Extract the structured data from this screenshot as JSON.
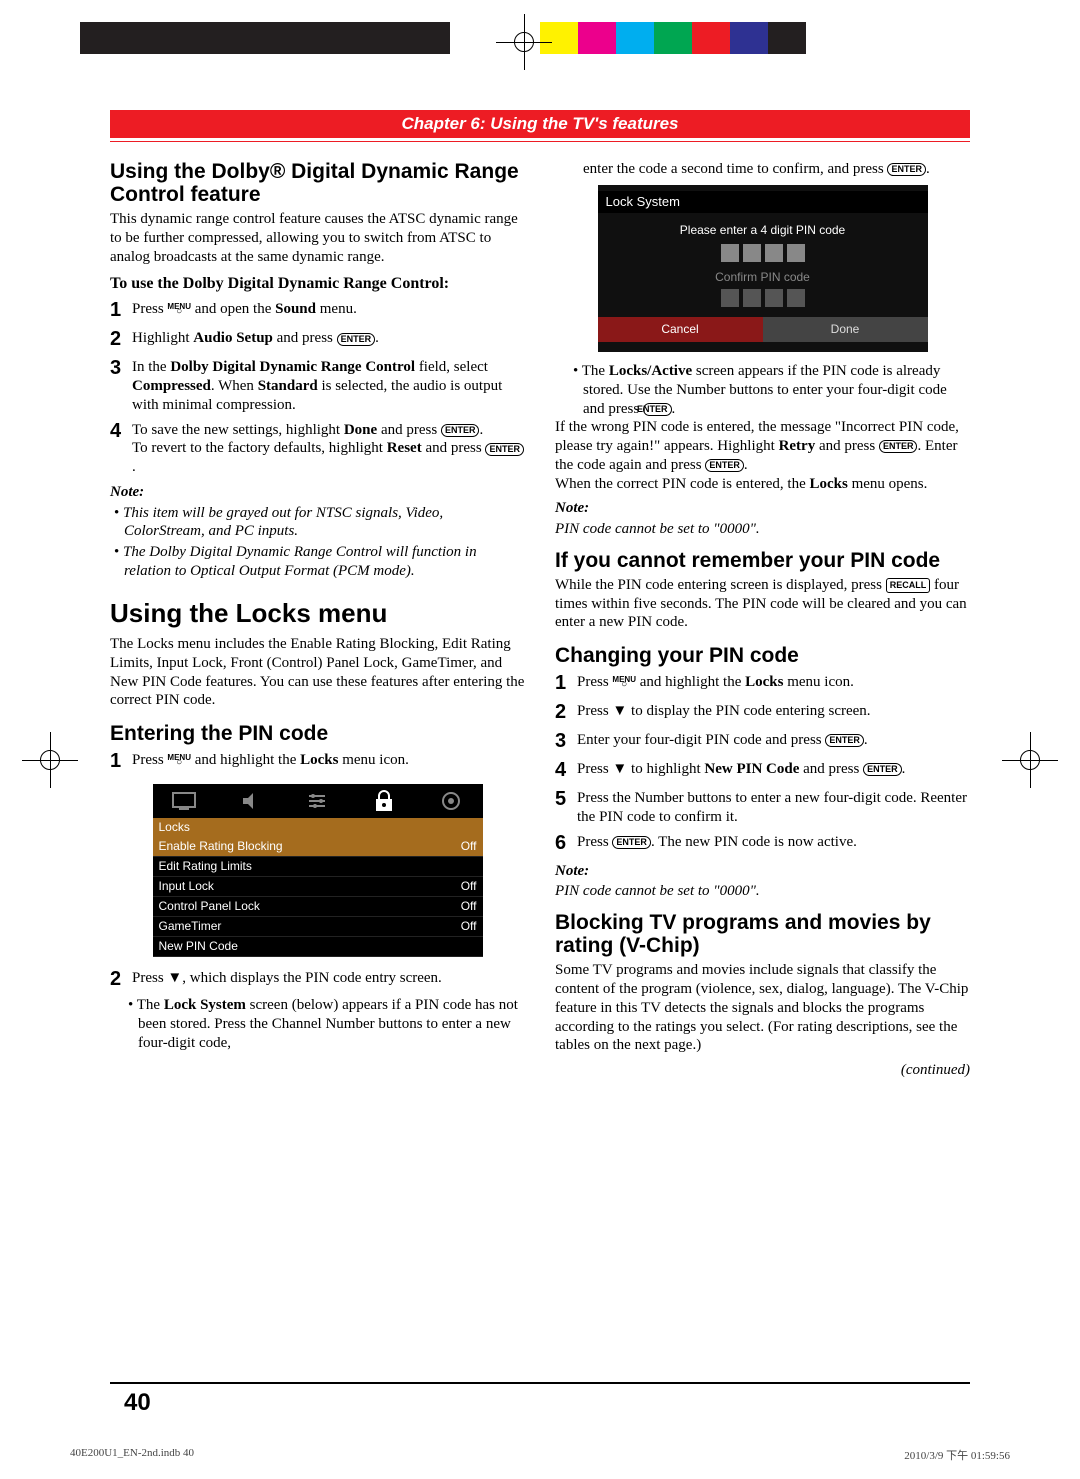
{
  "chapter_title": "Chapter 6: Using the TV's features",
  "col1": {
    "h_dolby": "Using the Dolby® Digital Dynamic Range Control feature",
    "dolby_intro": "This dynamic range control feature causes the ATSC dynamic range to be further compressed, allowing you to switch from ATSC to analog broadcasts at the same dynamic range.",
    "dolby_sub": "To use the Dolby Digital Dynamic Range Control:",
    "steps": {
      "s1a": "Press ",
      "s1b": " and open the ",
      "s1c": "Sound",
      "s1d": " menu.",
      "s2a": "Highlight ",
      "s2b": "Audio Setup",
      "s2c": " and press ",
      "s2d": ".",
      "s3a": "In the ",
      "s3b": "Dolby Digital Dynamic Range Control",
      "s3c": " field, select ",
      "s3d": "Compressed",
      "s3e": ". When ",
      "s3f": "Standard",
      "s3g": " is selected, the audio is output with minimal compression.",
      "s4a": "To save the new settings, highlight ",
      "s4b": "Done",
      "s4c": " and press ",
      "s4d": ".",
      "s4e": "To revert to the factory defaults, highlight ",
      "s4f": "Reset",
      "s4g": " and press ",
      "s4h": "."
    },
    "note_label": "Note:",
    "note1": "This item will be grayed out for NTSC signals, Video, ColorStream, and PC inputs.",
    "note2": "The Dolby Digital Dynamic Range Control will function in relation to Optical Output Format (PCM mode).",
    "h_locks": "Using the Locks menu",
    "locks_intro": "The Locks menu includes the Enable Rating Blocking, Edit Rating Limits, Input Lock, Front (Control) Panel Lock, GameTimer, and New PIN Code features. You can use these features after entering the correct PIN code.",
    "h_enter": "Entering the PIN code",
    "enter_s1a": "Press ",
    "enter_s1b": " and highlight the ",
    "enter_s1c": "Locks",
    "enter_s1d": " menu icon.",
    "enter_s2a": "Press ",
    "enter_s2b": ", which displays the PIN code entry screen.",
    "enter_b1a": "The ",
    "enter_b1b": "Lock System",
    "enter_b1c": " screen (below) appears if a PIN code has not been stored. Press the Channel Number buttons to enter a new four-digit code,"
  },
  "col2": {
    "cont_top1": "enter the code a second time to confirm, and press ",
    "cont_top2": ".",
    "tv2_title": "Lock System",
    "tv2_msg": "Please enter a 4 digit PIN code",
    "tv2_confirm": "Confirm PIN code",
    "tv2_cancel": "Cancel",
    "tv2_done": "Done",
    "bul1a": "The ",
    "bul1b": "Locks/Active",
    "bul1c": " screen appears if the PIN code is already stored. Use the Number buttons to enter your four-digit code and press ",
    "bul1d": ".",
    "wrong1": "If the wrong PIN code is entered, the message \"Incorrect PIN code, please try again!\" appears. Highlight ",
    "wrong2": "Retry",
    "wrong3": " and press ",
    "wrong4": ". Enter the code again and press ",
    "wrong5": ".",
    "correct1": "When the correct PIN code is entered, the ",
    "correct2": "Locks",
    "correct3": " menu opens.",
    "note_label": "Note:",
    "note_pin": "PIN code cannot be set to \"0000\".",
    "h_forgot": "If you cannot remember your PIN code",
    "forgot1": "While the PIN code entering screen is displayed, press ",
    "forgot2": " four times within five seconds. The PIN code will be cleared and you can enter a new PIN code.",
    "h_change": "Changing your PIN code",
    "csteps": {
      "c1a": "Press ",
      "c1b": " and highlight the ",
      "c1c": "Locks",
      "c1d": " menu icon.",
      "c2a": "Press ",
      "c2b": " to display the PIN code entering screen.",
      "c3a": "Enter your four-digit PIN code and press ",
      "c3b": ".",
      "c4a": "Press ",
      "c4b": " to highlight ",
      "c4c": "New PIN Code",
      "c4d": " and press ",
      "c4e": ".",
      "c5": "Press the Number buttons to enter a new four-digit code. Reenter the PIN code to confirm it.",
      "c6a": "Press ",
      "c6b": ". The new PIN code is now active."
    },
    "note_label2": "Note:",
    "note_pin2": "PIN code cannot be set to \"0000\".",
    "h_vchip": "Blocking TV programs and movies by rating (V-Chip)",
    "vchip_body": "Some TV programs and movies include signals that classify the content of the program (violence, sex, dialog, language). The V-Chip feature in this TV detects the signals and blocks the programs according to the ratings you select. (For rating descriptions, see the tables on the next page.)",
    "continued": "(continued)"
  },
  "locks_table": {
    "title": "Locks",
    "rows": [
      {
        "label": "Enable Rating Blocking",
        "val": "Off"
      },
      {
        "label": "Edit Rating Limits",
        "val": ""
      },
      {
        "label": "Input Lock",
        "val": "Off"
      },
      {
        "label": "Control Panel Lock",
        "val": "Off"
      },
      {
        "label": "GameTimer",
        "val": "Off"
      },
      {
        "label": "New PIN Code",
        "val": ""
      }
    ]
  },
  "page_number": "40",
  "footer_left": "40E200U1_EN-2nd.indb   40",
  "footer_right": "2010/3/9   下午 01:59:56",
  "buttons": {
    "enter": "ENTER",
    "menu_top": "MENU",
    "recall": "RECALL"
  }
}
